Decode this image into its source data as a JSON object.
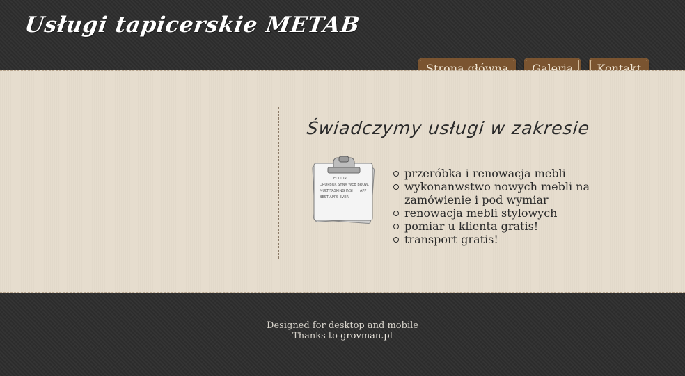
{
  "header": {
    "site_title": "Usługi tapicerskie METAB"
  },
  "nav": {
    "items": [
      {
        "label": "Strona główna"
      },
      {
        "label": "Galeria"
      },
      {
        "label": "Kontakt"
      }
    ]
  },
  "main": {
    "heading": "Świadczymy usługi w zakresie",
    "services": [
      "przeróbka i renowacja mebli",
      "wykonanwstwo nowych mebli na zamówienie i pod wymiar",
      "renowacja mebli stylowych",
      "pomiar u klienta gratis!",
      "transport gratis!"
    ],
    "clipboard_icon": "clipboard-icon",
    "clipboard_text": [
      "EDITOR",
      "DROPBOX SYNX WEB BROW.",
      "MULTITASKING INSI",
      "APP",
      "BEST APPS EVER"
    ]
  },
  "footer": {
    "line1": "Designed for desktop and mobile",
    "thanks_prefix": "Thanks to",
    "thanks_link": "grovman.pl"
  },
  "colors": {
    "dark_bg": "#2e2e2e",
    "paper_bg": "#e6dccd",
    "nav_button": "#7a5430"
  }
}
